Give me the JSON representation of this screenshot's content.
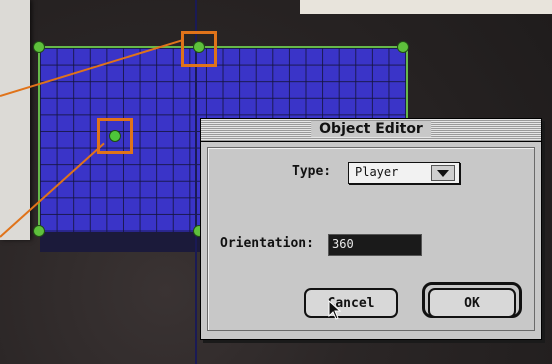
{
  "dialog": {
    "title": "Object Editor",
    "type_label": "Type:",
    "type_value": "Player",
    "orientation_label": "Orientation:",
    "orientation_value": "360",
    "cancel_label": "Cancel",
    "ok_label": "OK"
  },
  "icons": {
    "popup_arrow": "chevron-down-icon",
    "cursor": "arrow-pointer-icon"
  },
  "colors": {
    "grid_fill": "#3a34c8",
    "grid_border": "#66b84a",
    "highlight": "#e0731a"
  }
}
